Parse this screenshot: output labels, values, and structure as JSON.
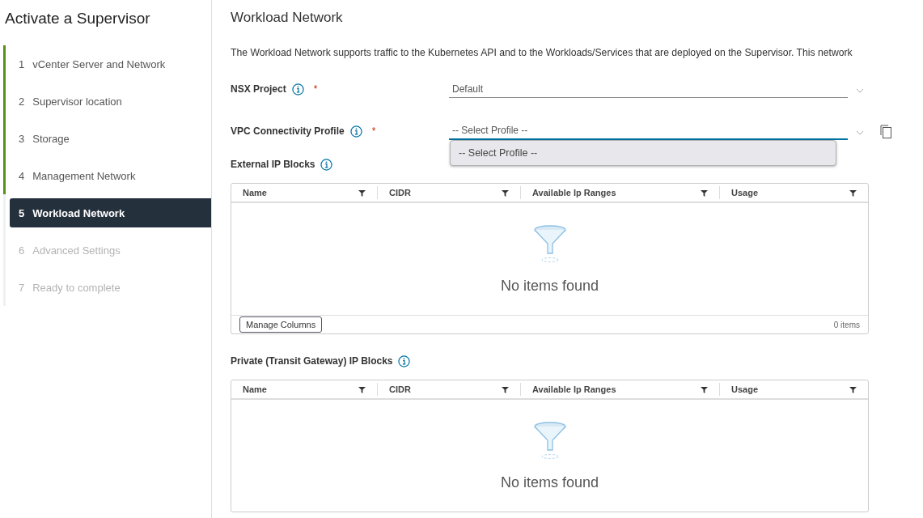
{
  "wizard": {
    "title": "Activate a Supervisor",
    "steps": [
      {
        "number": "1",
        "label": "vCenter Server and Network",
        "completed": true,
        "selected": false,
        "disabled": false
      },
      {
        "number": "2",
        "label": "Supervisor location",
        "completed": true,
        "selected": false,
        "disabled": false
      },
      {
        "number": "3",
        "label": "Storage",
        "completed": true,
        "selected": false,
        "disabled": false
      },
      {
        "number": "4",
        "label": "Management Network",
        "completed": true,
        "selected": false,
        "disabled": false
      },
      {
        "number": "5",
        "label": "Workload Network",
        "completed": false,
        "selected": true,
        "disabled": false
      },
      {
        "number": "6",
        "label": "Advanced Settings",
        "completed": false,
        "selected": false,
        "disabled": true
      },
      {
        "number": "7",
        "label": "Ready to complete",
        "completed": false,
        "selected": false,
        "disabled": true
      }
    ]
  },
  "page": {
    "title": "Workload Network",
    "description": "The Workload Network supports traffic to the Kubernetes API and to the Workloads/Services that are deployed on the Supervisor. This network",
    "fields": [
      {
        "label": "NSX Project",
        "required_mark": "*",
        "value": "Default",
        "focused": false,
        "copy_button": false
      },
      {
        "label": "VPC Connectivity Profile",
        "required_mark": "*",
        "value": "-- Select Profile --",
        "focused": true,
        "copy_button": true,
        "dropdown_options": [
          "-- Select Profile --"
        ]
      }
    ],
    "grids": [
      {
        "title": "External IP Blocks",
        "columns": [
          "Name",
          "CIDR",
          "Available Ip Ranges",
          "Usage"
        ],
        "empty_text": "No items found",
        "footer": {
          "button": "Manage Columns",
          "count": "0 items"
        }
      },
      {
        "title": "Private (Transit Gateway) IP Blocks",
        "columns": [
          "Name",
          "CIDR",
          "Available Ip Ranges",
          "Usage"
        ],
        "empty_text": "No items found"
      }
    ]
  }
}
